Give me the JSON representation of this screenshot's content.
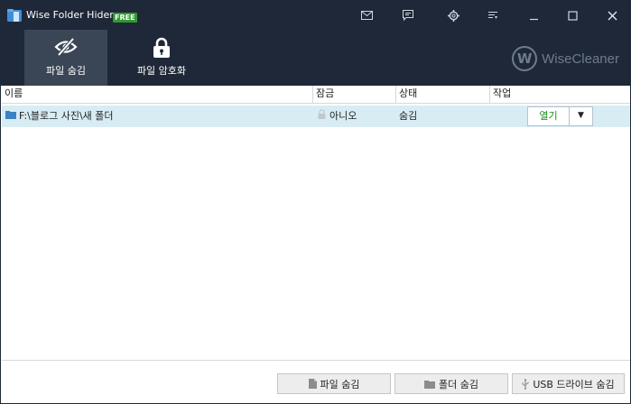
{
  "window": {
    "title": "Wise Folder Hider",
    "badge": "FREE",
    "title_buttons": [
      "mail-icon",
      "feedback-icon",
      "settings-icon",
      "menu-icon",
      "minimize-icon",
      "maximize-icon",
      "close-icon"
    ]
  },
  "nav": {
    "tabs": [
      {
        "label": "파일 숨김",
        "icon": "hidden-eye-icon",
        "active": true
      },
      {
        "label": "파일 암호화",
        "icon": "padlock-icon",
        "active": false
      }
    ],
    "brand": "WiseCleaner",
    "brand_mark": "W"
  },
  "table": {
    "columns": [
      "이름",
      "잠금",
      "상태",
      "작업"
    ],
    "rows": [
      {
        "name": "F:\\블로그 사진\\새 폴더",
        "lock": "아니오",
        "status": "숨김",
        "action": "열기",
        "action_dropdown": "▼"
      }
    ]
  },
  "footer": {
    "buttons": [
      {
        "label": "파일 숨김",
        "icon": "file-icon"
      },
      {
        "label": "폴더 숨김",
        "icon": "folder-icon"
      },
      {
        "label": "USB 드라이브 숨김",
        "icon": "usb-icon"
      }
    ]
  },
  "colors": {
    "titlebar_bg": "#1f2838",
    "active_tab_bg": "#3a4556",
    "row_highlight": "#d8ecf4",
    "action_text": "#1a8a1a",
    "free_badge": "#2e9b2e"
  }
}
